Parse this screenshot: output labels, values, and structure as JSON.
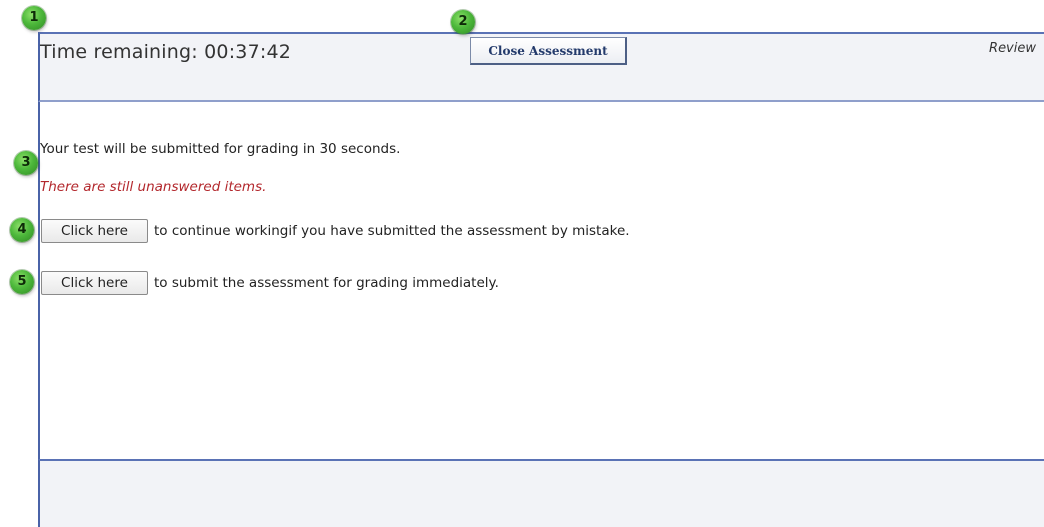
{
  "header": {
    "timer_text": "Time remaining: 00:37:42",
    "close_button_label": "Close Assessment",
    "review_label": "Review"
  },
  "messages": {
    "submit_notice": "Your test will be submitted for grading in 30 seconds.",
    "unanswered_warning": "There are still unanswered items."
  },
  "actions": {
    "continue_button_label": "Click here",
    "continue_text": "to continue workingif you have submitted the assessment by mistake.",
    "submit_button_label": "Click here",
    "submit_text": "to submit the assessment for grading immediately."
  },
  "callouts": [
    "1",
    "2",
    "3",
    "4",
    "5"
  ],
  "colors": {
    "frame_border": "#4a63a8",
    "bar_background": "#f2f3f7",
    "warning_text": "#b3282d",
    "callout_green": "#4db83b"
  }
}
